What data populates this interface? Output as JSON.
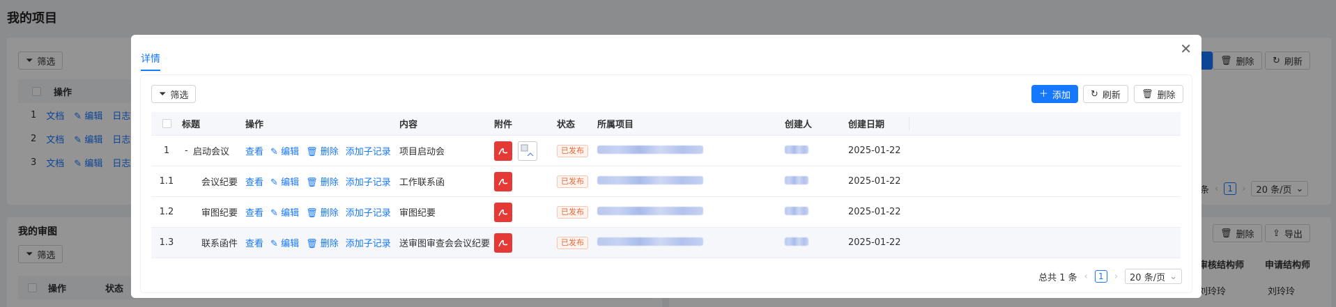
{
  "background": {
    "page_title": "我的项目",
    "filter_label": "筛选",
    "delete_label": "删除",
    "refresh_label": "刷新",
    "col_ops": "操作",
    "rows": [
      {
        "idx": "1",
        "doc": "文档",
        "edit": "编辑",
        "log": "日志"
      },
      {
        "idx": "2",
        "doc": "文档",
        "edit": "编辑",
        "log": "日志"
      },
      {
        "idx": "3",
        "doc": "文档",
        "edit": "编辑",
        "log": "日志"
      }
    ],
    "pager_tail": "条",
    "pager_page": "1",
    "pager_size": "20 条/页",
    "review_title": "我的审图",
    "review_cols": [
      "操作",
      "状态"
    ],
    "export_label": "导出",
    "right_cols": [
      "审核结构师",
      "申请结构师"
    ],
    "right_values": [
      "刘玲玲",
      "刘玲玲"
    ]
  },
  "dialog": {
    "tab": "详情",
    "toolbar": {
      "filter": "筛选",
      "add": "添加",
      "refresh": "刷新",
      "delete": "删除"
    },
    "columns": [
      "标题",
      "操作",
      "内容",
      "附件",
      "状态",
      "所属项目",
      "创建人",
      "创建日期"
    ],
    "ops": {
      "view": "查看",
      "edit": "编辑",
      "delete": "删除",
      "add_child": "添加子记录"
    },
    "rows": [
      {
        "idx": "1",
        "title": "启动会议",
        "collapse": "-",
        "content": "项目启动会",
        "status": "已发布",
        "date": "2025-01-22",
        "attachments": [
          "pdf",
          "broken-image"
        ]
      },
      {
        "idx": "1.1",
        "title": "会议纪要",
        "collapse": "",
        "content": "工作联系函",
        "status": "已发布",
        "date": "2025-01-22",
        "attachments": [
          "pdf"
        ]
      },
      {
        "idx": "1.2",
        "title": "审图纪要",
        "collapse": "",
        "content": "审图纪要",
        "status": "已发布",
        "date": "2025-01-22",
        "attachments": [
          "pdf"
        ]
      },
      {
        "idx": "1.3",
        "title": "联系函件",
        "collapse": "",
        "content": "送审图审查会会议纪要",
        "status": "已发布",
        "date": "2025-01-22",
        "attachments": [
          "pdf"
        ]
      }
    ],
    "pager": {
      "total": "总共 1 条",
      "page": "1",
      "size": "20 条/页"
    }
  },
  "colors": {
    "primary": "#1677ff",
    "status_tag": "#e06b3c",
    "pdf_red": "#e53935"
  }
}
